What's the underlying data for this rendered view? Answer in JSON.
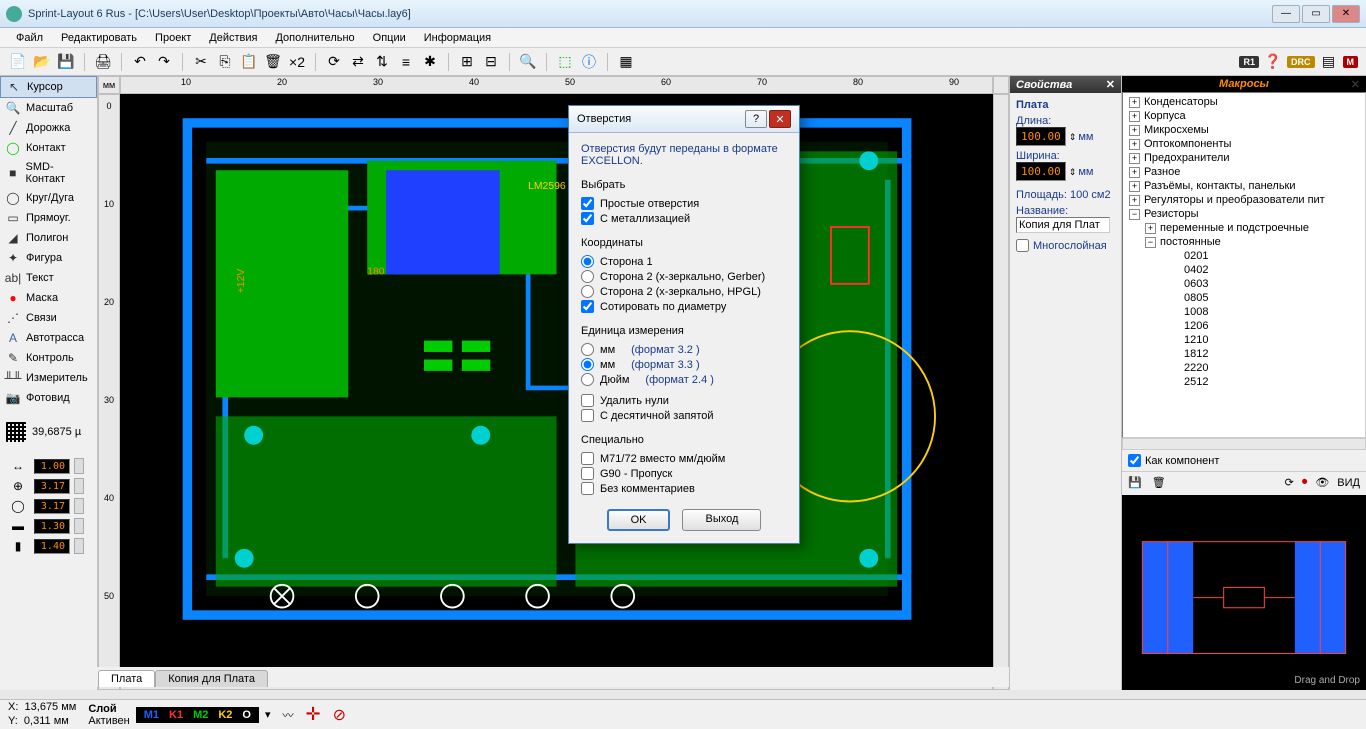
{
  "title": "Sprint-Layout 6 Rus - [C:\\Users\\User\\Desktop\\Проекты\\Авто\\Часы\\Часы.lay6]",
  "menu": [
    "Файл",
    "Редактировать",
    "Проект",
    "Действия",
    "Дополнительно",
    "Опции",
    "Информация"
  ],
  "tools": [
    {
      "icon": "↖",
      "label": "Курсор",
      "active": true
    },
    {
      "icon": "🔍",
      "label": "Масштаб"
    },
    {
      "icon": "╱",
      "label": "Дорожка"
    },
    {
      "icon": "◯",
      "label": "Контакт",
      "color": "#00cc00"
    },
    {
      "icon": "■",
      "label": "SMD-Контакт"
    },
    {
      "icon": "◯",
      "label": "Круг/Дуга"
    },
    {
      "icon": "▭",
      "label": "Прямоуг."
    },
    {
      "icon": "◢",
      "label": "Полигон"
    },
    {
      "icon": "✦",
      "label": "Фигура"
    },
    {
      "icon": "ab|",
      "label": "Текст"
    },
    {
      "icon": "●",
      "label": "Маска",
      "color": "#ff0000"
    },
    {
      "icon": "⋰",
      "label": "Связи"
    },
    {
      "icon": "A",
      "label": "Автотрасса",
      "color": "#4060a0"
    },
    {
      "icon": "✎",
      "label": "Контроль"
    },
    {
      "icon": "╨╨",
      "label": "Измеритель"
    },
    {
      "icon": "📷",
      "label": "Фотовид"
    }
  ],
  "grid": "39,6875 µ",
  "params": [
    {
      "icon": "↔",
      "val": "1.00"
    },
    {
      "icon": "⊕",
      "val": "3.17"
    },
    {
      "icon": "◯",
      "val": "3.17"
    },
    {
      "icon": "▬",
      "val": "1.30"
    },
    {
      "icon": "▮",
      "val": "1.40"
    }
  ],
  "rulerH": [
    "мм",
    "10",
    "20",
    "30",
    "40",
    "50",
    "60",
    "70",
    "80",
    "90"
  ],
  "rulerV": [
    "0",
    "10",
    "20",
    "30",
    "40",
    "50"
  ],
  "tabs": [
    "Плата",
    "Копия для Плата"
  ],
  "activeTab": 0,
  "props": {
    "title": "Свойства",
    "header": "Плата",
    "width_lbl": "Длина:",
    "width_val": "100.00",
    "height_lbl": "Ширина:",
    "height_val": "100.00",
    "unit_tip": "мм",
    "area_lbl": "Площадь:",
    "area_val": "100 см2",
    "name_lbl": "Название:",
    "name_val": "Копия для Плат",
    "multilayer": "Многослойная"
  },
  "macros": {
    "title": "Макросы",
    "tree": [
      {
        "ind": 0,
        "exp": "+",
        "label": "Конденсаторы"
      },
      {
        "ind": 0,
        "exp": "+",
        "label": "Корпуса"
      },
      {
        "ind": 0,
        "exp": "+",
        "label": "Микросхемы"
      },
      {
        "ind": 0,
        "exp": "+",
        "label": "Оптокомпоненты"
      },
      {
        "ind": 0,
        "exp": "+",
        "label": "Предохранители"
      },
      {
        "ind": 0,
        "exp": "+",
        "label": "Разное"
      },
      {
        "ind": 0,
        "exp": "+",
        "label": "Разъёмы, контакты, панельки"
      },
      {
        "ind": 0,
        "exp": "+",
        "label": "Регуляторы и преобразователи пит"
      },
      {
        "ind": 0,
        "exp": "−",
        "label": "Резисторы"
      },
      {
        "ind": 1,
        "exp": "+",
        "label": "переменные и подстроечные"
      },
      {
        "ind": 1,
        "exp": "−",
        "label": "постоянные"
      },
      {
        "ind": 2,
        "label": "0201"
      },
      {
        "ind": 2,
        "label": "0402"
      },
      {
        "ind": 2,
        "label": "0603"
      },
      {
        "ind": 2,
        "label": "0805"
      },
      {
        "ind": 2,
        "label": "1008"
      },
      {
        "ind": 2,
        "label": "1206"
      },
      {
        "ind": 2,
        "label": "1210"
      },
      {
        "ind": 2,
        "label": "1812"
      },
      {
        "ind": 2,
        "label": "2220"
      },
      {
        "ind": 2,
        "label": "2512"
      }
    ],
    "as_component": "Как компонент",
    "view_lbl": "ВИД",
    "dnd": "Drag and Drop"
  },
  "status": {
    "x_lbl": "X:",
    "x": "13,675 мм",
    "y_lbl": "Y:",
    "y": "0,311 мм",
    "layer_lbl": "Слой",
    "active_lbl": "Активен",
    "layers": [
      {
        "t": "M1",
        "c": "#2060ff"
      },
      {
        "t": "K1",
        "c": "#ff3030"
      },
      {
        "t": "M2",
        "c": "#00cc00"
      },
      {
        "t": "K2",
        "c": "#ffd000"
      },
      {
        "t": "O",
        "c": "#ffffff"
      }
    ]
  },
  "dialog": {
    "title": "Отверстия",
    "intro": "Отверстия будут переданы в формате EXCELLON.",
    "select_hdr": "Выбрать",
    "cb_simple": "Простые отверстия",
    "cb_metal": "С металлизацией",
    "coord_hdr": "Координаты",
    "r_side1": "Сторона 1",
    "r_side2g": "Сторона 2 (x-зеркально, Gerber)",
    "r_side2h": "Сторона 2 (x-зеркально, HPGL)",
    "cb_sort": "Сотировать по диаметру",
    "unit_hdr": "Единица измерения",
    "u_mm1": "мм",
    "u_mm1_fmt": "(формат 3.2 )",
    "u_mm2": "мм",
    "u_mm2_fmt": "(формат 3.3 )",
    "u_in": "Дюйм",
    "u_in_fmt": "(формат 2.4 )",
    "cb_delzero": "Удалить нули",
    "cb_decimal": "С десятичной запятой",
    "spec_hdr": "Специально",
    "cb_m71": "M71/72 вместо мм/дюйм",
    "cb_g90": "G90 - Пропуск",
    "cb_nocomm": "Без комментариев",
    "btn_ok": "OK",
    "btn_exit": "Выход"
  }
}
